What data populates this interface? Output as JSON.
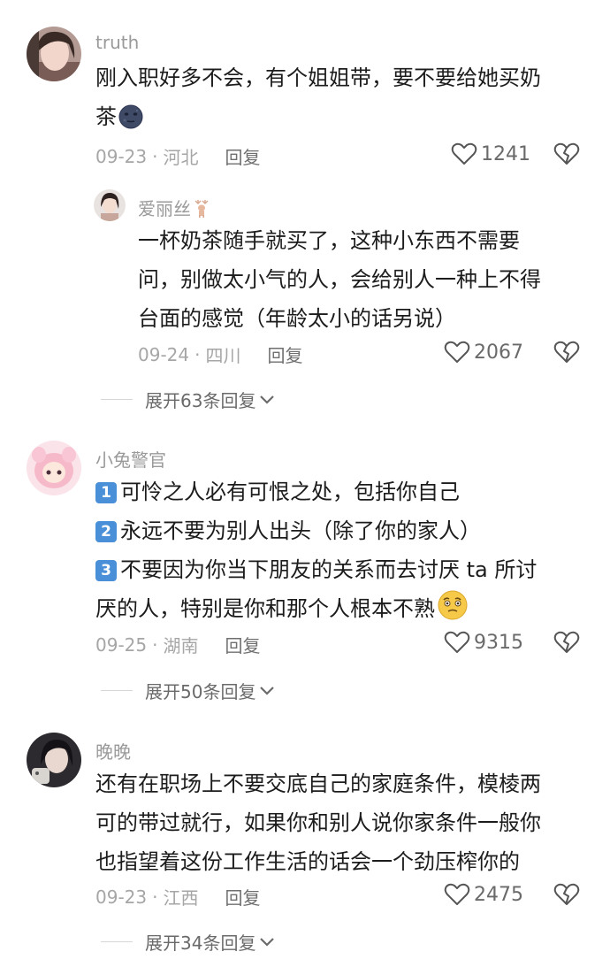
{
  "comments": [
    {
      "username": "truth",
      "lines": [
        "刚入职好多不会，有个姐姐带，要不要给她买奶",
        "茶"
      ],
      "date": "09-23",
      "location": "河北",
      "reply_label": "回复",
      "likes": "1241",
      "replies": [
        {
          "username": "爱丽丝",
          "lines": [
            "一杯奶茶随手就买了，这种小东西不需要",
            "问，别做太小气的人，会给别人一种上不得",
            "台面的感觉（年龄太小的话另说）"
          ],
          "date": "09-24",
          "location": "四川",
          "reply_label": "回复",
          "likes": "2067"
        }
      ],
      "expand_label": "展开63条回复"
    },
    {
      "username": "小兔警官",
      "badges": [
        "1",
        "2",
        "3"
      ],
      "lines": [
        "可怜之人必有可恨之处，包括你自己",
        "永远不要为别人出头（除了你的家人）",
        "不要因为你当下朋友的关系而去讨厌 ta 所讨",
        "厌的人，特别是你和那个人根本不熟"
      ],
      "date": "09-25",
      "location": "湖南",
      "reply_label": "回复",
      "likes": "9315",
      "expand_label": "展开50条回复"
    },
    {
      "username": "晚晚",
      "lines": [
        "还有在职场上不要交底自己的家庭条件，模棱两",
        "可的带过就行，如果你和别人说你家条件一般你",
        "也指望着这份工作生活的话会一个劲压榨你的"
      ],
      "date": "09-23",
      "location": "江西",
      "reply_label": "回复",
      "likes": "2475",
      "expand_label": "展开34条回复"
    }
  ],
  "separator": "·",
  "icons": {
    "like": "heart-outline-icon",
    "dislike": "broken-heart-icon",
    "expand": "chevron-down-icon",
    "emoji1": "moon-face-emoji-icon",
    "emoji2": "thinking-face-emoji-icon",
    "deer": "deer-icon"
  },
  "colors": {
    "badge_blue": "#4a90d9",
    "meta_gray": "#a6a6a6",
    "username_gray": "#9a9a9a"
  }
}
